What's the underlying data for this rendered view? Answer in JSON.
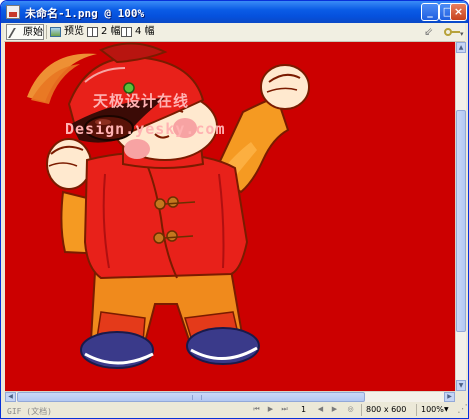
{
  "window": {
    "title": "未命名-1.png @ 100%",
    "buttons": {
      "minimize": "_",
      "maximize": "□",
      "close": "×"
    }
  },
  "toolbar": {
    "original_label": "原始",
    "preview_label": "预览",
    "twoup_label": "2 幅",
    "fourup_label": "4 幅"
  },
  "canvas": {
    "background_color": "#cc0000",
    "watermark_line1": "天极设计在线",
    "watermark_line2": "Design.yesky.com"
  },
  "statusbar": {
    "format_text": "GIF (文档)",
    "frame_number": "1",
    "document_size": "800 x 600",
    "zoom": "100%"
  },
  "colors": {
    "titlebar": "#0b5ce6",
    "chrome": "#ece9d8"
  }
}
